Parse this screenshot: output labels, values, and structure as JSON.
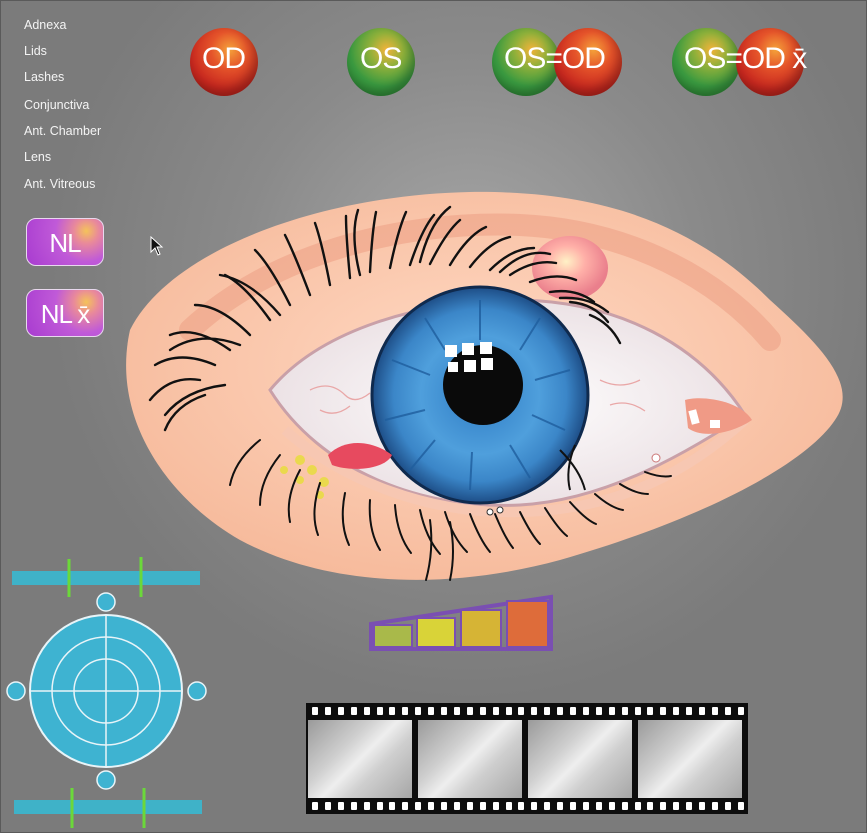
{
  "menu": {
    "items": [
      "Adnexa",
      "Lids",
      "Lashes",
      "Conjunctiva",
      "Ant. Chamber",
      "Lens",
      "Ant. Vitreous"
    ]
  },
  "eye_buttons": {
    "od": "OD",
    "os": "OS",
    "os_eq_od": "OS=OD",
    "os_eq_od_x": "OS=OD x̄"
  },
  "nl_buttons": {
    "nl": "NL",
    "nl_x": "NL x̄"
  },
  "severity_scale": {
    "levels": 4,
    "colors": [
      "#a9b94a",
      "#d9d338",
      "#d6b435",
      "#de6c3a"
    ],
    "border_color": "#7a4fb2"
  },
  "filmstrip": {
    "frames": 4
  },
  "colors": {
    "od_red": "#c8281f",
    "os_green": "#3a9a40",
    "nl_purple": "#b048d0",
    "slider_teal": "#3fb2c8",
    "slider_marker": "#6bd83a"
  }
}
